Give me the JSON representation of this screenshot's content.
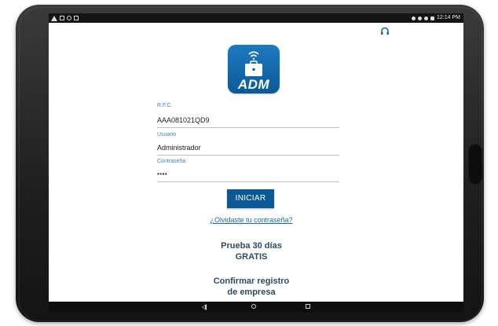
{
  "status_bar": {
    "time": "12:14 PM"
  },
  "icons": {
    "support": "headset-icon",
    "logo": "briefcase-wifi-icon"
  },
  "app": {
    "logo_text": "ADM",
    "accent_color": "#0a5894"
  },
  "form": {
    "rfc_label": "R.F.C.",
    "rfc_value": "AAA081021QD9",
    "user_label": "Usuario",
    "user_value": "Administrador",
    "password_label": "Contraseña",
    "password_value": "••••"
  },
  "actions": {
    "login_label": "INICIAR",
    "forgot_label": "¿Olvidaste tu contraseña?",
    "trial_line1": "Prueba 30 días",
    "trial_line2": "GRATIS",
    "confirm_line1": "Confirmar registro",
    "confirm_line2": "de empresa"
  }
}
